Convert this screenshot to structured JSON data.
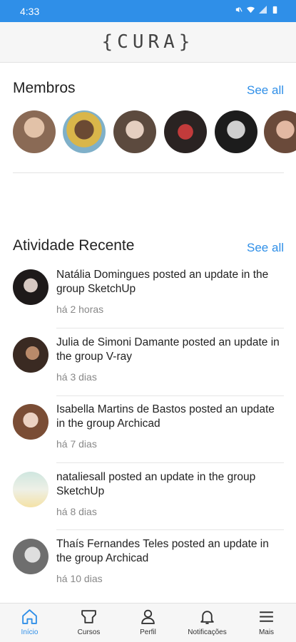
{
  "status_bar": {
    "time": "4:33"
  },
  "app_bar": {
    "logo": "{CURA}"
  },
  "members": {
    "title": "Membros",
    "see_all": "See all",
    "avatars": [
      "member-1",
      "member-2",
      "member-3",
      "member-4",
      "member-5",
      "member-6"
    ]
  },
  "activity": {
    "title": "Atividade Recente",
    "see_all": "See all",
    "items": [
      {
        "text": "Natália Domingues posted an update in the group SketchUp",
        "time": "há 2 horas"
      },
      {
        "text": "Julia de Simoni Damante posted an update in the group V-ray",
        "time": "há 3 dias"
      },
      {
        "text": "Isabella Martins de Bastos posted an update in the group Archicad",
        "time": "há 7 dias"
      },
      {
        "text": "nataliesall posted an update in the group SketchUp",
        "time": "há 8 dias"
      },
      {
        "text": "Thaís Fernandes Teles posted an update in the group Archicad",
        "time": "há 10 dias"
      }
    ]
  },
  "tabs": [
    {
      "label": "Início",
      "icon": "home-icon"
    },
    {
      "label": "Cursos",
      "icon": "courses-icon"
    },
    {
      "label": "Perfil",
      "icon": "profile-icon"
    },
    {
      "label": "Notificações",
      "icon": "bell-icon"
    },
    {
      "label": "Mais",
      "icon": "menu-icon"
    }
  ],
  "colors": {
    "accent": "#2f8fe8",
    "status_bar": "#2f8fe8"
  }
}
